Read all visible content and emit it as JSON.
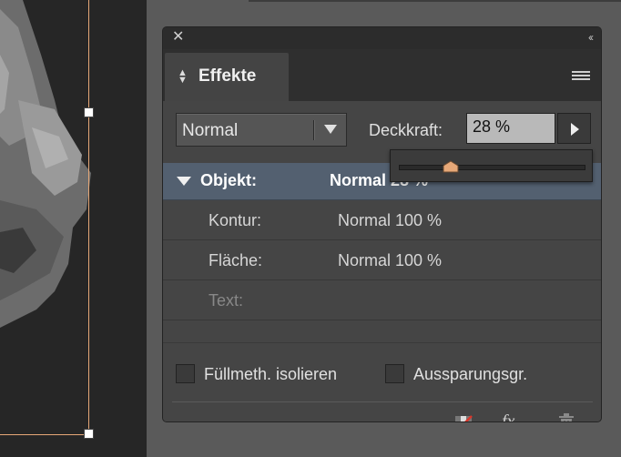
{
  "panel": {
    "tab_label": "Effekte",
    "blend_mode": "Normal",
    "opacity_label": "Deckkraft:",
    "opacity_value": "28 %",
    "opacity_percent": 28
  },
  "layers": [
    {
      "label": "Objekt:",
      "value": "Normal 28 %",
      "selected": true
    },
    {
      "label": "Kontur:",
      "value": "Normal 100 %",
      "selected": false
    },
    {
      "label": "Fläche:",
      "value": "Normal 100 %",
      "selected": false
    },
    {
      "label": "Text:",
      "value": "",
      "selected": false
    }
  ],
  "options": {
    "isolate_blending": "Füllmeth. isolieren",
    "knockout_group": "Aussparungsgr."
  },
  "footer": {
    "fx_label": "fx"
  },
  "icons": {
    "close": "close-icon",
    "collapse": "collapse-icon",
    "tab_sort": "updown-icon",
    "menu": "panel-menu-icon",
    "clear_effects": "clear-effects-icon",
    "fx": "fx-icon",
    "delete": "trash-icon"
  },
  "colors": {
    "panel_bg": "#454545",
    "selection": "#536070",
    "slider_thumb": "#e6a878",
    "frame_edge": "#e6a878"
  }
}
